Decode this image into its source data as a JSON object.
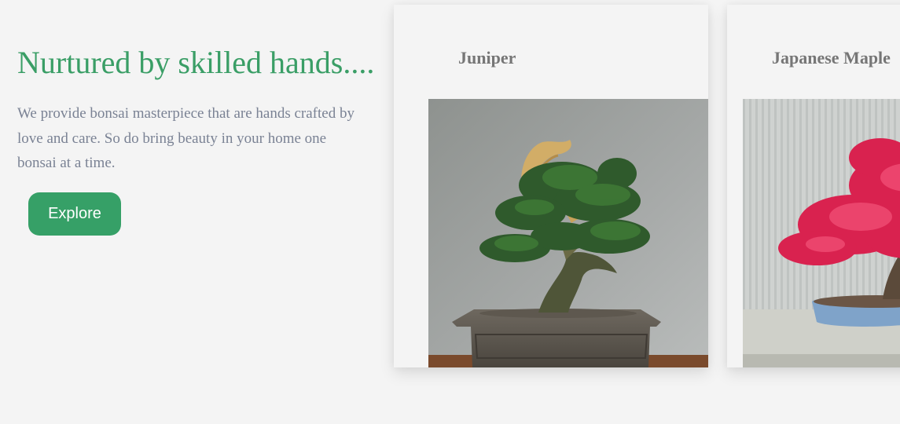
{
  "hero": {
    "title": "Nurtured by skilled hands....",
    "description": "We provide bonsai masterpiece that are hands crafted by love and care. So do bring beauty in your home one bonsai at a time.",
    "button_label": "Explore"
  },
  "cards": [
    {
      "title": "Juniper",
      "image": "juniper-bonsai-image"
    },
    {
      "title": "Japanese Maple",
      "image": "japanese-maple-bonsai-image"
    }
  ],
  "colors": {
    "accent": "#36a067",
    "title_green": "#3a9e66",
    "body_text": "#7a8294",
    "background": "#f4f4f4"
  }
}
